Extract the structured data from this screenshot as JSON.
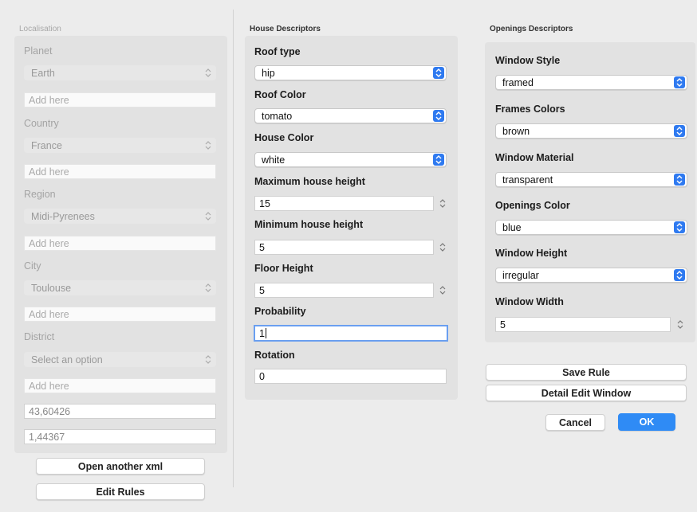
{
  "localisation": {
    "title": "Localisation",
    "planet": {
      "label": "Planet",
      "value": "Earth",
      "add_placeholder": "Add here"
    },
    "country": {
      "label": "Country",
      "value": "France",
      "add_placeholder": "Add here"
    },
    "region": {
      "label": "Region",
      "value": "Midi-Pyrenees",
      "add_placeholder": "Add here"
    },
    "city": {
      "label": "City",
      "value": "Toulouse",
      "add_placeholder": "Add here"
    },
    "district": {
      "label": "District",
      "value": "Select an option",
      "add_placeholder": "Add here"
    },
    "latitude": "43,60426",
    "longitude": "1,44367"
  },
  "house": {
    "title": "House Descriptors",
    "roof_type": {
      "label": "Roof type",
      "value": "hip"
    },
    "roof_color": {
      "label": "Roof Color",
      "value": "tomato"
    },
    "house_color": {
      "label": "House Color",
      "value": "white"
    },
    "max_height": {
      "label": "Maximum house height",
      "value": "15"
    },
    "min_height": {
      "label": "Minimum house height",
      "value": "5"
    },
    "floor_height": {
      "label": "Floor Height",
      "value": "5"
    },
    "probability": {
      "label": "Probability",
      "value": "1"
    },
    "rotation": {
      "label": "Rotation",
      "value": "0"
    }
  },
  "openings": {
    "title": "Openings Descriptors",
    "window_style": {
      "label": "Window Style",
      "value": "framed"
    },
    "frames_colors": {
      "label": "Frames Colors",
      "value": "brown"
    },
    "window_material": {
      "label": "Window Material",
      "value": "transparent"
    },
    "openings_color": {
      "label": "Openings Color",
      "value": "blue"
    },
    "window_height": {
      "label": "Window Height",
      "value": "irregular"
    },
    "window_width": {
      "label": "Window Width",
      "value": "5"
    }
  },
  "actions": {
    "save_rule": "Save Rule",
    "detail_edit": "Detail Edit Window",
    "cancel": "Cancel",
    "ok": "OK",
    "open_xml": "Open another xml",
    "edit_rules": "Edit Rules"
  },
  "colors": {
    "accent": "#2f7af0",
    "ok_button": "#2f8bf5",
    "panel": "#e2e2e2"
  },
  "icons": {
    "select": "chevron-updown-icon",
    "stepper": "stepper-icon"
  }
}
